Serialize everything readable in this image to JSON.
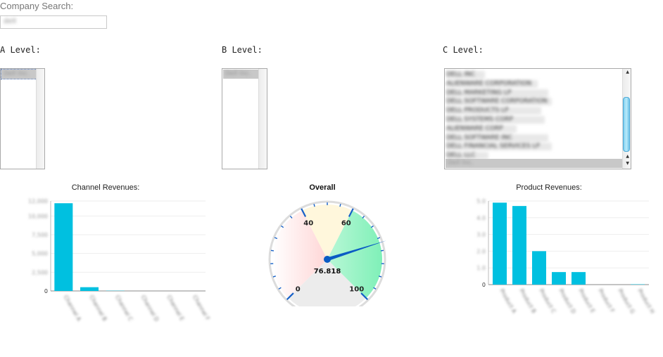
{
  "search": {
    "label": "Company Search:",
    "value": "dell"
  },
  "levels": {
    "a": {
      "label": "A Level:",
      "selected": "Dell Inc."
    },
    "b": {
      "label": "B Level:",
      "selected": "Dell Inc."
    },
    "c": {
      "label": "C Level:",
      "items": [
        "DELL INC",
        "ALIENWARE CORPORATION",
        "DELL MARKETING LP",
        "DELL SOFTWARE CORPORATION",
        "DELL PRODUCTS LP",
        "DELL SYSTEMS CORP",
        "ALIENWARE CORP",
        "DELL SOFTWARE INC",
        "DELL FINANCIAL SERVICES LP",
        "DELL LLC"
      ],
      "selected": "Dell Inc.",
      "scroll_fraction": 0.35
    }
  },
  "colors": {
    "bar": "#00c0e0",
    "needle": "#0a5bc4",
    "zone_red": "#ffd6d6",
    "zone_yellow": "#fff7dc",
    "zone_green": "#7ff0b8"
  },
  "chart_data": [
    {
      "type": "bar",
      "title": "Channel Revenues:",
      "categories": [
        "Channel A",
        "Channel B",
        "Channel C",
        "Channel D",
        "Channel E",
        "Channel F"
      ],
      "values": [
        11700,
        500,
        30,
        0,
        0,
        0
      ],
      "ylim": [
        0,
        12000
      ],
      "ytick_labels": [
        "12,000",
        "10,000",
        "7,500",
        "5,000",
        "2,500",
        "0"
      ],
      "ytick_values": [
        12000,
        10000,
        7500,
        5000,
        2500,
        0
      ],
      "grid": true
    },
    {
      "type": "gauge",
      "title": "Overall",
      "value": 76.818,
      "value_label": "76.818",
      "range": [
        0,
        100
      ],
      "tick_labels": [
        "0",
        "40",
        "60",
        "100"
      ]
    },
    {
      "type": "bar",
      "title": "Product Revenues:",
      "categories": [
        "Product A",
        "Product B",
        "Product C",
        "Product D",
        "Product E",
        "Product F",
        "Product G",
        "Product H"
      ],
      "values": [
        4.9,
        4.7,
        2.0,
        0.75,
        0.75,
        0,
        0,
        0.02
      ],
      "ylim": [
        0,
        5
      ],
      "ytick_labels": [
        "5.0",
        "4.0",
        "3.0",
        "2.0",
        "1.0",
        "0"
      ],
      "ytick_values": [
        5,
        4,
        3,
        2,
        1,
        0
      ],
      "grid": true
    }
  ]
}
